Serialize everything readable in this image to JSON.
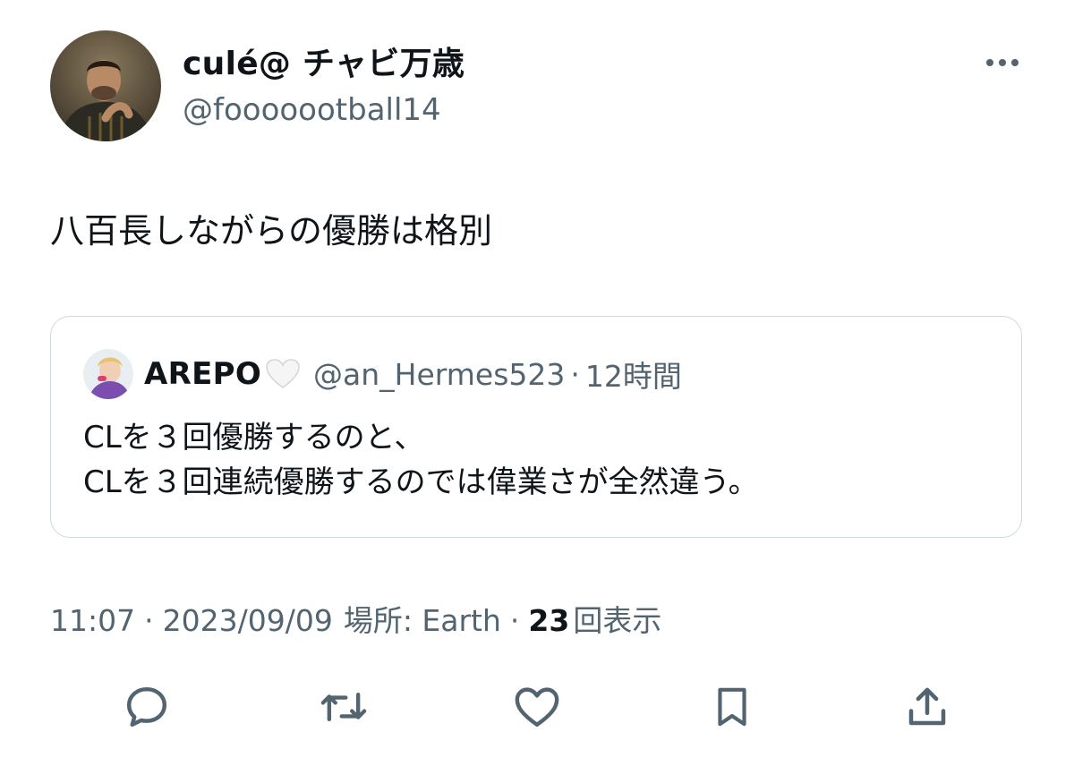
{
  "tweet": {
    "author": {
      "display_name": "culé@ チャビ万歳",
      "handle": "@fooooootball14",
      "avatar_icon": "profile-photo"
    },
    "text": "八百長しながらの優勝は格別",
    "quote": {
      "author_name": "AREPO",
      "emoji": "🤍",
      "handle": "@an_Hermes523",
      "separator": "·",
      "time": "12時間",
      "lines": [
        "CLを３回優勝するのと、",
        "CLを３回連続優勝するのでは偉業さが全然違う。"
      ]
    },
    "meta": {
      "time": "11:07",
      "date": "2023/09/09",
      "location": "場所: Earth",
      "separator": "·",
      "view_count": "23",
      "view_label": "回表示"
    },
    "actions": [
      {
        "name": "reply",
        "icon": "reply-icon"
      },
      {
        "name": "retweet",
        "icon": "retweet-icon"
      },
      {
        "name": "like",
        "icon": "heart-icon"
      },
      {
        "name": "bookmark",
        "icon": "bookmark-icon"
      },
      {
        "name": "share",
        "icon": "share-icon"
      }
    ]
  },
  "colors": {
    "text_primary": "#0f1419",
    "text_secondary": "#536471",
    "border": "#cfd9de",
    "icon": "#536471"
  }
}
